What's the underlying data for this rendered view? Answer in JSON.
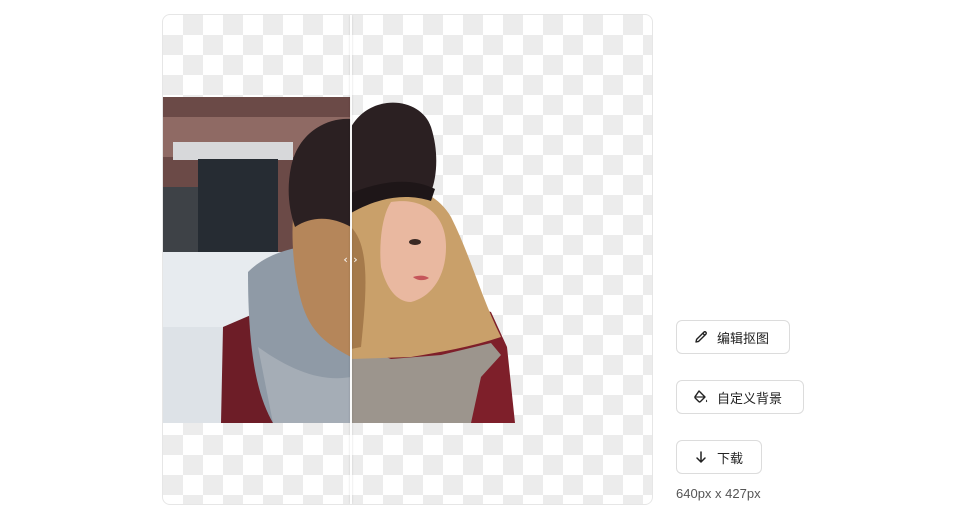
{
  "actions": {
    "edit_cutout": "编辑抠图",
    "custom_background": "自定义背景",
    "download": "下载"
  },
  "image_dimensions": "640px x 427px",
  "compare_handle": "‹ ›",
  "icons": {
    "edit": "pencil-icon",
    "background": "paint-bucket-icon",
    "download": "arrow-down-icon"
  }
}
